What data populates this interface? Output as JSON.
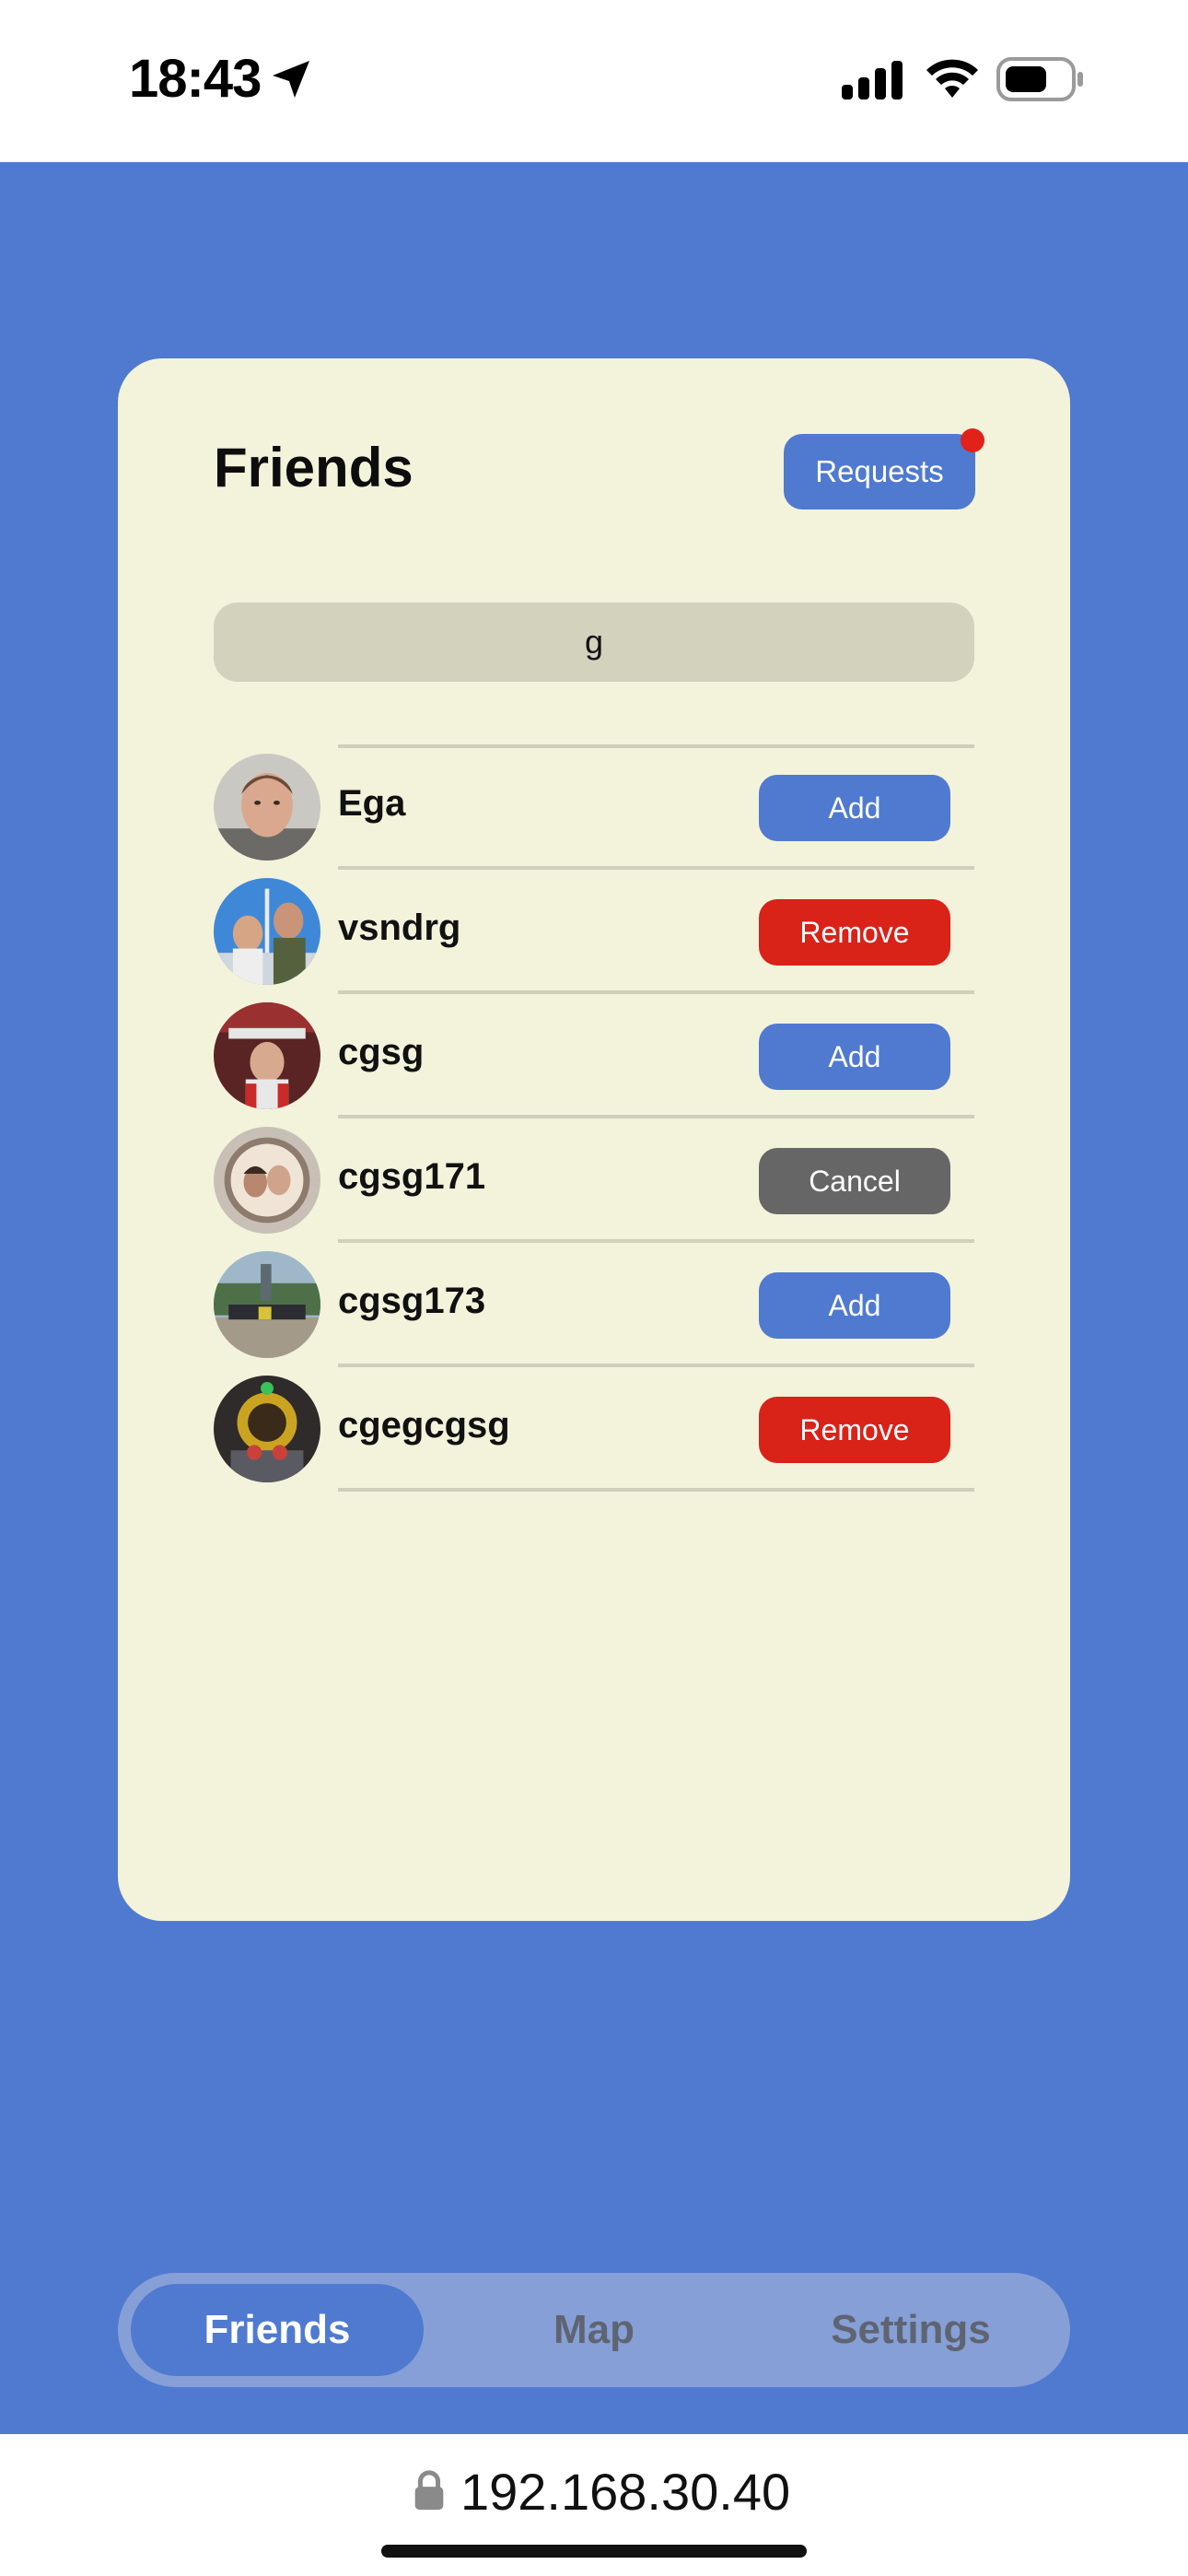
{
  "status_bar": {
    "time": "18:43",
    "icons": [
      "location-arrow-icon",
      "cellular-signal-icon",
      "wifi-icon",
      "battery-icon"
    ]
  },
  "card": {
    "title": "Friends",
    "requests_label": "Requests",
    "has_pending_requests": true
  },
  "search": {
    "value": "g"
  },
  "friends": [
    {
      "username": "Ega",
      "action": "Add",
      "action_color": "#4f7acf"
    },
    {
      "username": "vsndrg",
      "action": "Remove",
      "action_color": "#d92218"
    },
    {
      "username": "cgsg",
      "action": "Add",
      "action_color": "#4f7acf"
    },
    {
      "username": "cgsg171",
      "action": "Cancel",
      "action_color": "#666666"
    },
    {
      "username": "cgsg173",
      "action": "Add",
      "action_color": "#4f7acf"
    },
    {
      "username": "cgegcgsg",
      "action": "Remove",
      "action_color": "#d92218"
    }
  ],
  "tabs": [
    {
      "label": "Friends",
      "active": true
    },
    {
      "label": "Map",
      "active": false
    },
    {
      "label": "Settings",
      "active": false
    }
  ],
  "browser": {
    "url": "192.168.30.40"
  },
  "colors": {
    "background": "#4f7acf",
    "card": "#f3f3dc",
    "search": "#d3d2bd",
    "notification_dot": "#e0221b"
  }
}
